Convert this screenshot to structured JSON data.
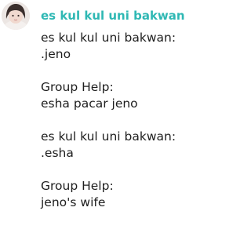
{
  "message": {
    "sender": "es kul kul uni bakwan",
    "avatar_icon": "profile-photo-avatar",
    "accent_color": "#2fb8b4",
    "lines": [
      "es kul kul uni bakwan:",
      ".jeno",
      "",
      "Group Help:",
      "esha pacar jeno",
      "",
      "es kul kul uni bakwan:",
      ".esha",
      "",
      "Group Help:",
      "jeno's wife"
    ]
  }
}
